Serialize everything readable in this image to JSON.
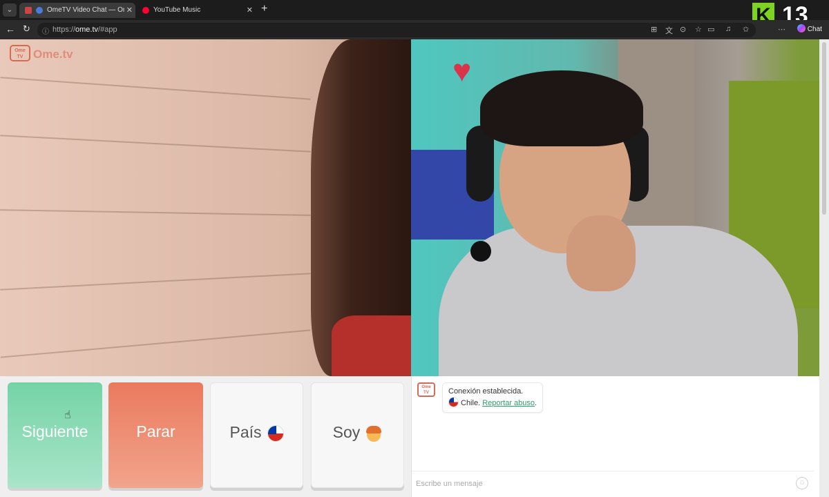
{
  "browser": {
    "tabs": [
      {
        "title": "OmeTV Video Chat — Omegle",
        "active": true
      },
      {
        "title": "YouTube Music",
        "active": false
      }
    ],
    "url_prefix": "https://",
    "url_host": "ome.tv",
    "url_path": "/#app",
    "chat_label": "Chat",
    "overlay_logo": "K",
    "overlay_number": "13"
  },
  "app": {
    "logo_tv_label": "Ome\nTV",
    "logo_text": "Ome.tv",
    "controls": {
      "next_label": "Siguiente",
      "stop_label": "Parar",
      "country_label": "País",
      "gender_label": "Soy"
    },
    "chat": {
      "system_line1": "Conexión establecida.",
      "country_name": "Chile.",
      "report_link": "Reportar abuso",
      "report_suffix": ".",
      "input_placeholder": "Escribe un mensaje"
    }
  },
  "icons": {
    "tab_list": "chevron-down-icon",
    "back": "arrow-left-icon",
    "reload": "reload-icon",
    "new_tab": "plus-icon",
    "emoji": "smiley-icon",
    "country_flag": "chile-flag-icon",
    "gender": "boy-emoji-icon"
  },
  "colors": {
    "next_button": "#74d3a6",
    "stop_button": "#ea7a5e",
    "brand": "#d96a52",
    "report_link": "#28a06b"
  }
}
